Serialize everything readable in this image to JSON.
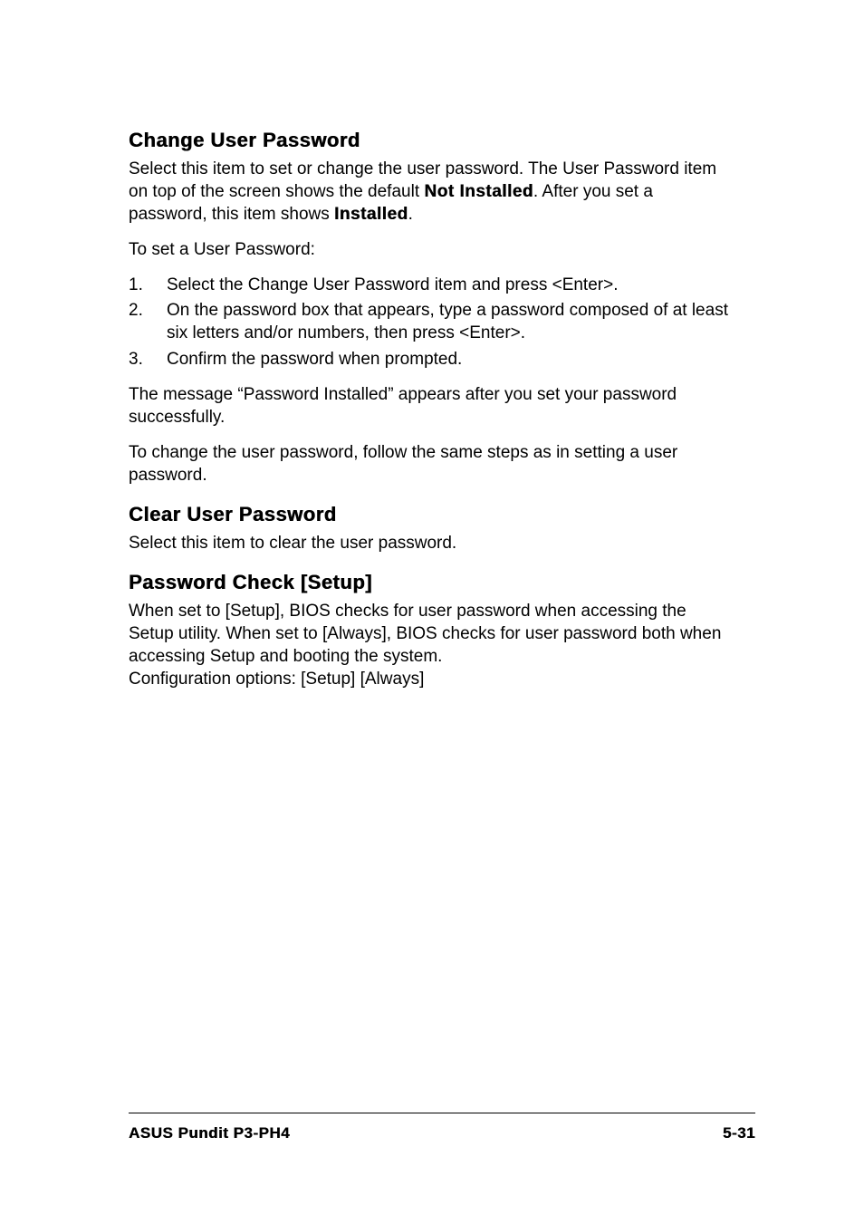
{
  "sections": {
    "change_user_password": {
      "heading": "Change User Password",
      "para1_a": "Select this item to set or change the user password. The User Password item on top of the screen shows the default ",
      "para1_bold1": "Not Installed",
      "para1_b": ". After you set a password, this item shows ",
      "para1_bold2": "Installed",
      "para1_c": ".",
      "para2": "To set a User Password:",
      "steps": [
        {
          "num": "1.",
          "text": "Select the Change User Password item and press <Enter>."
        },
        {
          "num": "2.",
          "text": "On the password box that appears, type a password composed of at least six letters and/or numbers, then press <Enter>."
        },
        {
          "num": "3.",
          "text": "Confirm the password when prompted."
        }
      ],
      "para3": "The message “Password Installed” appears after you set your password successfully.",
      "para4": "To change the user password, follow the same steps as in setting a user password."
    },
    "clear_user_password": {
      "heading": "Clear User Password",
      "para1": "Select this item to clear the user password."
    },
    "password_check": {
      "heading": "Password Check [Setup]",
      "para1": "When set to [Setup], BIOS checks for user password when accessing the Setup utility. When set to [Always], BIOS checks for user password both when accessing Setup and booting the system.",
      "para2": "Configuration options: [Setup] [Always]"
    }
  },
  "footer": {
    "left": "ASUS Pundit P3-PH4",
    "right": "5-31"
  }
}
